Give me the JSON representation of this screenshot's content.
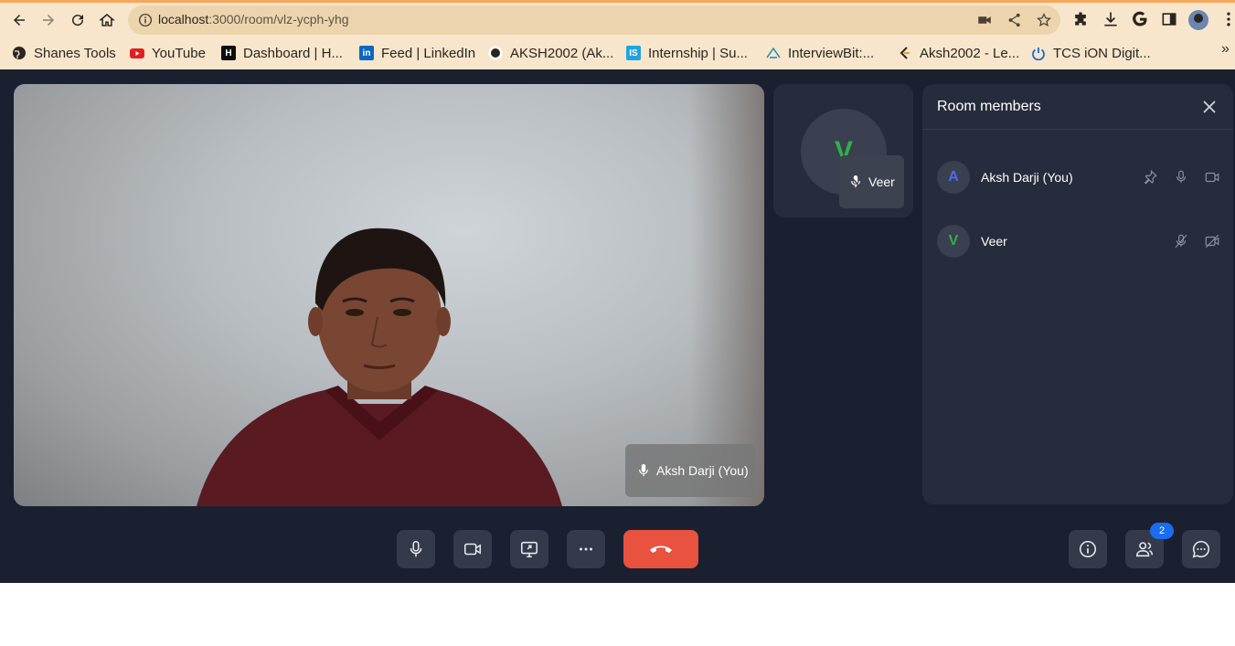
{
  "browser": {
    "url_host": "localhost",
    "url_path": ":3000/room/vlz-ycph-yhg",
    "bookmarks": [
      {
        "label": "Shanes Tools",
        "icon": "globe-icon"
      },
      {
        "label": "YouTube",
        "icon": "youtube-icon"
      },
      {
        "label": "Dashboard | H...",
        "icon": "hackerrank-icon"
      },
      {
        "label": "Feed | LinkedIn",
        "icon": "linkedin-icon"
      },
      {
        "label": "AKSH2002 (Ak...",
        "icon": "github-icon"
      },
      {
        "label": "Internship | Su...",
        "icon": "internshala-icon"
      },
      {
        "label": "InterviewBit:...",
        "icon": "interviewbit-icon"
      },
      {
        "label": "Aksh2002 - Le...",
        "icon": "leetcode-icon"
      },
      {
        "label": "TCS iON Digit...",
        "icon": "tcs-icon"
      }
    ],
    "more": "»"
  },
  "room": {
    "main_participant": "Aksh Darji (You)",
    "side_participant": {
      "initial": "V",
      "name": "Veer"
    },
    "members_panel": {
      "title": "Room members",
      "members": [
        {
          "initial": "A",
          "name": "Aksh Darji (You)",
          "color": "#4f6bf0"
        },
        {
          "initial": "V",
          "name": "Veer",
          "color": "#2fb24a"
        }
      ]
    },
    "participants_count": "2"
  },
  "colors": {
    "app_bg": "#1b2030",
    "panel_bg": "#262c3c",
    "end_call": "#e8523f",
    "badge": "#1a6cf0",
    "chrome_bg": "#f7e6cc"
  }
}
